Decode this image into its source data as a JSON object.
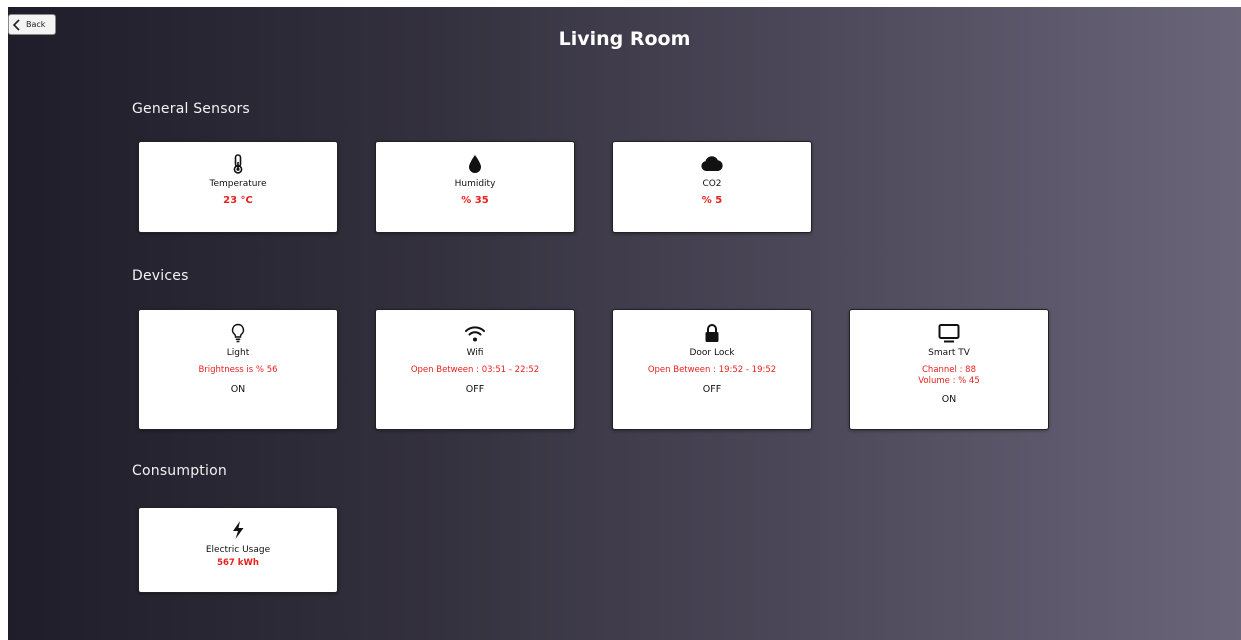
{
  "back_button": {
    "label": "Back",
    "icon": "chevron-left-icon"
  },
  "page_title": "Living Room",
  "colors": {
    "value_red": "#e8211d",
    "card_bg": "#ffffff",
    "text_dark": "#111111"
  },
  "sections": {
    "sensors": {
      "title": "General Sensors",
      "cards": [
        {
          "icon": "thermometer-icon",
          "name": "Temperature",
          "value": "23 °C"
        },
        {
          "icon": "water-drop-icon",
          "name": "Humidity",
          "value": "% 35"
        },
        {
          "icon": "cloud-icon",
          "name": "CO2",
          "value": "% 5"
        }
      ]
    },
    "devices": {
      "title": "Devices",
      "cards": [
        {
          "icon": "lightbulb-icon",
          "name": "Light",
          "info": "Brightness is % 56",
          "state": "ON"
        },
        {
          "icon": "wifi-icon",
          "name": "Wifi",
          "info": "Open Between : 03:51 - 22:52",
          "state": "OFF"
        },
        {
          "icon": "lock-icon",
          "name": "Door Lock",
          "info": "Open Between : 19:52 - 19:52",
          "state": "OFF"
        },
        {
          "icon": "tv-icon",
          "name": "Smart TV",
          "info": "Channel : 88",
          "info2": "Volume : % 45",
          "state": "ON"
        }
      ]
    },
    "consumption": {
      "title": "Consumption",
      "cards": [
        {
          "icon": "lightning-bolt-icon",
          "name": "Electric Usage",
          "value": "567 kWh"
        }
      ]
    }
  }
}
